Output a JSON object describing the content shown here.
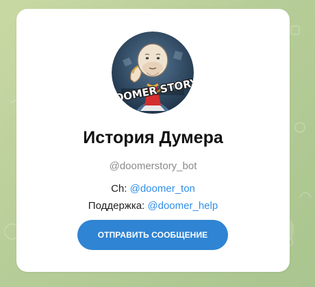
{
  "colors": {
    "background": "#b9cf9a",
    "card": "#ffffff",
    "link": "#2f8ee7",
    "button": "#2f84d3",
    "button_text": "#ffffff"
  },
  "profile": {
    "avatar_caption": "DOOMER STORY",
    "title": "История Думера",
    "username": "@doomerstory_bot",
    "channel_label": "Ch:",
    "channel_link": "@doomer_ton",
    "support_label": "Поддержка:",
    "support_link": "@doomer_help"
  },
  "actions": {
    "send_message_label": "ОТПРАВИТЬ СООБЩЕНИЕ"
  }
}
